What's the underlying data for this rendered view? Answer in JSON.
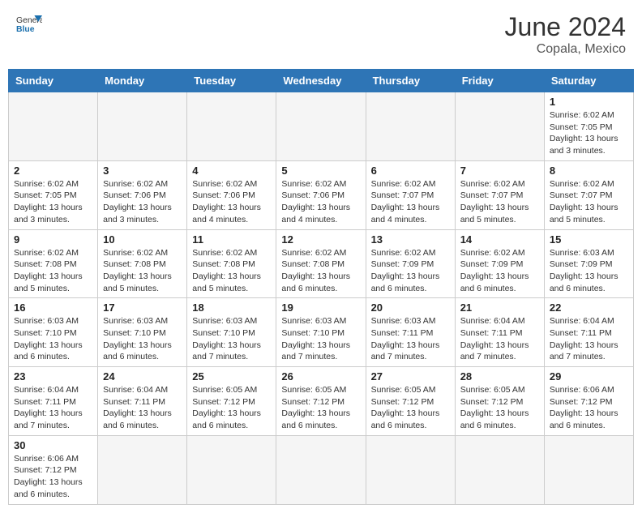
{
  "header": {
    "logo_general": "General",
    "logo_blue": "Blue",
    "month_year": "June 2024",
    "location": "Copala, Mexico"
  },
  "weekdays": [
    "Sunday",
    "Monday",
    "Tuesday",
    "Wednesday",
    "Thursday",
    "Friday",
    "Saturday"
  ],
  "weeks": [
    [
      {
        "day": "",
        "info": "",
        "empty": true
      },
      {
        "day": "",
        "info": "",
        "empty": true
      },
      {
        "day": "",
        "info": "",
        "empty": true
      },
      {
        "day": "",
        "info": "",
        "empty": true
      },
      {
        "day": "",
        "info": "",
        "empty": true
      },
      {
        "day": "",
        "info": "",
        "empty": true
      },
      {
        "day": "1",
        "info": "Sunrise: 6:02 AM\nSunset: 7:05 PM\nDaylight: 13 hours and 3 minutes."
      }
    ],
    [
      {
        "day": "2",
        "info": "Sunrise: 6:02 AM\nSunset: 7:05 PM\nDaylight: 13 hours and 3 minutes."
      },
      {
        "day": "3",
        "info": "Sunrise: 6:02 AM\nSunset: 7:06 PM\nDaylight: 13 hours and 3 minutes."
      },
      {
        "day": "4",
        "info": "Sunrise: 6:02 AM\nSunset: 7:06 PM\nDaylight: 13 hours and 4 minutes."
      },
      {
        "day": "5",
        "info": "Sunrise: 6:02 AM\nSunset: 7:06 PM\nDaylight: 13 hours and 4 minutes."
      },
      {
        "day": "6",
        "info": "Sunrise: 6:02 AM\nSunset: 7:07 PM\nDaylight: 13 hours and 4 minutes."
      },
      {
        "day": "7",
        "info": "Sunrise: 6:02 AM\nSunset: 7:07 PM\nDaylight: 13 hours and 5 minutes."
      },
      {
        "day": "8",
        "info": "Sunrise: 6:02 AM\nSunset: 7:07 PM\nDaylight: 13 hours and 5 minutes."
      }
    ],
    [
      {
        "day": "9",
        "info": "Sunrise: 6:02 AM\nSunset: 7:08 PM\nDaylight: 13 hours and 5 minutes."
      },
      {
        "day": "10",
        "info": "Sunrise: 6:02 AM\nSunset: 7:08 PM\nDaylight: 13 hours and 5 minutes."
      },
      {
        "day": "11",
        "info": "Sunrise: 6:02 AM\nSunset: 7:08 PM\nDaylight: 13 hours and 5 minutes."
      },
      {
        "day": "12",
        "info": "Sunrise: 6:02 AM\nSunset: 7:08 PM\nDaylight: 13 hours and 6 minutes."
      },
      {
        "day": "13",
        "info": "Sunrise: 6:02 AM\nSunset: 7:09 PM\nDaylight: 13 hours and 6 minutes."
      },
      {
        "day": "14",
        "info": "Sunrise: 6:02 AM\nSunset: 7:09 PM\nDaylight: 13 hours and 6 minutes."
      },
      {
        "day": "15",
        "info": "Sunrise: 6:03 AM\nSunset: 7:09 PM\nDaylight: 13 hours and 6 minutes."
      }
    ],
    [
      {
        "day": "16",
        "info": "Sunrise: 6:03 AM\nSunset: 7:10 PM\nDaylight: 13 hours and 6 minutes."
      },
      {
        "day": "17",
        "info": "Sunrise: 6:03 AM\nSunset: 7:10 PM\nDaylight: 13 hours and 6 minutes."
      },
      {
        "day": "18",
        "info": "Sunrise: 6:03 AM\nSunset: 7:10 PM\nDaylight: 13 hours and 7 minutes."
      },
      {
        "day": "19",
        "info": "Sunrise: 6:03 AM\nSunset: 7:10 PM\nDaylight: 13 hours and 7 minutes."
      },
      {
        "day": "20",
        "info": "Sunrise: 6:03 AM\nSunset: 7:11 PM\nDaylight: 13 hours and 7 minutes."
      },
      {
        "day": "21",
        "info": "Sunrise: 6:04 AM\nSunset: 7:11 PM\nDaylight: 13 hours and 7 minutes."
      },
      {
        "day": "22",
        "info": "Sunrise: 6:04 AM\nSunset: 7:11 PM\nDaylight: 13 hours and 7 minutes."
      }
    ],
    [
      {
        "day": "23",
        "info": "Sunrise: 6:04 AM\nSunset: 7:11 PM\nDaylight: 13 hours and 7 minutes."
      },
      {
        "day": "24",
        "info": "Sunrise: 6:04 AM\nSunset: 7:11 PM\nDaylight: 13 hours and 6 minutes."
      },
      {
        "day": "25",
        "info": "Sunrise: 6:05 AM\nSunset: 7:12 PM\nDaylight: 13 hours and 6 minutes."
      },
      {
        "day": "26",
        "info": "Sunrise: 6:05 AM\nSunset: 7:12 PM\nDaylight: 13 hours and 6 minutes."
      },
      {
        "day": "27",
        "info": "Sunrise: 6:05 AM\nSunset: 7:12 PM\nDaylight: 13 hours and 6 minutes."
      },
      {
        "day": "28",
        "info": "Sunrise: 6:05 AM\nSunset: 7:12 PM\nDaylight: 13 hours and 6 minutes."
      },
      {
        "day": "29",
        "info": "Sunrise: 6:06 AM\nSunset: 7:12 PM\nDaylight: 13 hours and 6 minutes."
      }
    ],
    [
      {
        "day": "30",
        "info": "Sunrise: 6:06 AM\nSunset: 7:12 PM\nDaylight: 13 hours and 6 minutes."
      },
      {
        "day": "",
        "info": "",
        "empty": true
      },
      {
        "day": "",
        "info": "",
        "empty": true
      },
      {
        "day": "",
        "info": "",
        "empty": true
      },
      {
        "day": "",
        "info": "",
        "empty": true
      },
      {
        "day": "",
        "info": "",
        "empty": true
      },
      {
        "day": "",
        "info": "",
        "empty": true
      }
    ]
  ]
}
